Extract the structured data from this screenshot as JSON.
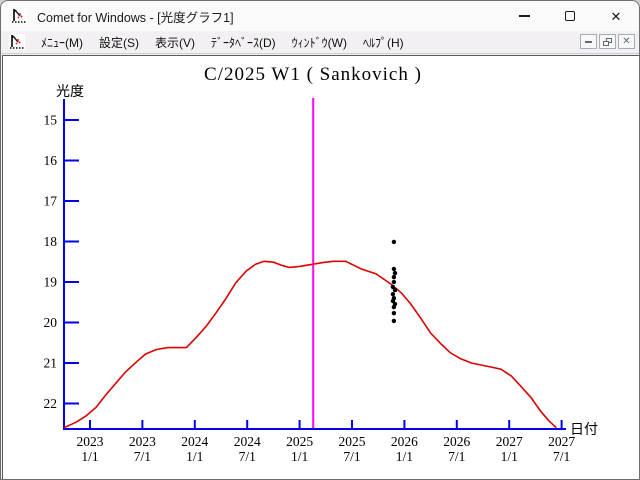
{
  "window": {
    "title": "Comet for Windows - [光度グラフ1]"
  },
  "icons": {
    "app_icon": "comet-light-curve-chart",
    "minimize": "–",
    "maximize": "□",
    "close": "✕",
    "mdi_minimize": "–",
    "mdi_restore": "❐",
    "mdi_close": "✕"
  },
  "menu_bar": {
    "items": [
      {
        "label": "ﾒﾆｭｰ(M)"
      },
      {
        "label": "設定(S)"
      },
      {
        "label": "表示(V)"
      },
      {
        "label": "ﾃﾞｰﾀﾍﾞｰｽ(D)"
      },
      {
        "label": "ｳｨﾝﾄﾞｳ(W)"
      },
      {
        "label": "ﾍﾙﾌﾟ(H)"
      }
    ]
  },
  "chart_data": {
    "type": "line+scatter",
    "title": "C/2025 W1 ( Sankovich )",
    "xlabel": "日付",
    "ylabel": "光度",
    "axis_color": "#0000ee",
    "grid": false,
    "y_inverted": true,
    "y_ticks": [
      15,
      16,
      17,
      18,
      19,
      20,
      21,
      22
    ],
    "y_range": [
      14.5,
      22.6
    ],
    "x_range": [
      2022.75,
      2027.54
    ],
    "x_ticks": [
      {
        "year": "2023",
        "day": "1/1",
        "x": 2023.0
      },
      {
        "year": "2023",
        "day": "7/1",
        "x": 2023.5
      },
      {
        "year": "2024",
        "day": "1/1",
        "x": 2024.0
      },
      {
        "year": "2024",
        "day": "7/1",
        "x": 2024.5
      },
      {
        "year": "2025",
        "day": "1/1",
        "x": 2025.0
      },
      {
        "year": "2025",
        "day": "7/1",
        "x": 2025.5
      },
      {
        "year": "2026",
        "day": "1/1",
        "x": 2026.0
      },
      {
        "year": "2026",
        "day": "7/1",
        "x": 2026.5
      },
      {
        "year": "2027",
        "day": "1/1",
        "x": 2027.0
      },
      {
        "year": "2027",
        "day": "7/1",
        "x": 2027.5
      }
    ],
    "event_line": {
      "x": 2025.13,
      "color": "#ff00ff"
    },
    "series": [
      {
        "name": "predicted-light-curve",
        "type": "line",
        "color": "#dc0000",
        "points": [
          [
            2022.75,
            22.6
          ],
          [
            2022.87,
            22.46
          ],
          [
            2022.96,
            22.31
          ],
          [
            2023.06,
            22.09
          ],
          [
            2023.15,
            21.79
          ],
          [
            2023.25,
            21.49
          ],
          [
            2023.34,
            21.22
          ],
          [
            2023.44,
            20.98
          ],
          [
            2023.53,
            20.78
          ],
          [
            2023.63,
            20.67
          ],
          [
            2023.74,
            20.62
          ],
          [
            2023.92,
            20.62
          ],
          [
            2024.01,
            20.38
          ],
          [
            2024.11,
            20.09
          ],
          [
            2024.2,
            19.77
          ],
          [
            2024.3,
            19.4
          ],
          [
            2024.39,
            19.02
          ],
          [
            2024.49,
            18.73
          ],
          [
            2024.58,
            18.56
          ],
          [
            2024.66,
            18.49
          ],
          [
            2024.75,
            18.51
          ],
          [
            2024.82,
            18.58
          ],
          [
            2024.9,
            18.64
          ],
          [
            2024.99,
            18.62
          ],
          [
            2025.13,
            18.56
          ],
          [
            2025.22,
            18.52
          ],
          [
            2025.32,
            18.49
          ],
          [
            2025.44,
            18.49
          ],
          [
            2025.59,
            18.68
          ],
          [
            2025.73,
            18.8
          ],
          [
            2025.87,
            19.05
          ],
          [
            2025.97,
            19.27
          ],
          [
            2026.06,
            19.54
          ],
          [
            2026.16,
            19.91
          ],
          [
            2026.25,
            20.26
          ],
          [
            2026.35,
            20.53
          ],
          [
            2026.44,
            20.75
          ],
          [
            2026.54,
            20.9
          ],
          [
            2026.64,
            21.0
          ],
          [
            2026.73,
            21.05
          ],
          [
            2026.83,
            21.1
          ],
          [
            2026.92,
            21.15
          ],
          [
            2027.02,
            21.32
          ],
          [
            2027.11,
            21.57
          ],
          [
            2027.21,
            21.86
          ],
          [
            2027.3,
            22.19
          ],
          [
            2027.38,
            22.43
          ],
          [
            2027.45,
            22.6
          ]
        ]
      },
      {
        "name": "observations",
        "type": "scatter",
        "color": "#000000",
        "points": [
          [
            2025.9,
            18.01
          ],
          [
            2025.9,
            18.68
          ],
          [
            2025.91,
            18.78
          ],
          [
            2025.9,
            18.88
          ],
          [
            2025.9,
            19.0
          ],
          [
            2025.89,
            19.12
          ],
          [
            2025.91,
            19.2
          ],
          [
            2025.89,
            19.3
          ],
          [
            2025.9,
            19.4
          ],
          [
            2025.89,
            19.47
          ],
          [
            2025.91,
            19.54
          ],
          [
            2025.9,
            19.62
          ],
          [
            2025.9,
            19.77
          ],
          [
            2025.9,
            19.96
          ]
        ]
      }
    ]
  }
}
